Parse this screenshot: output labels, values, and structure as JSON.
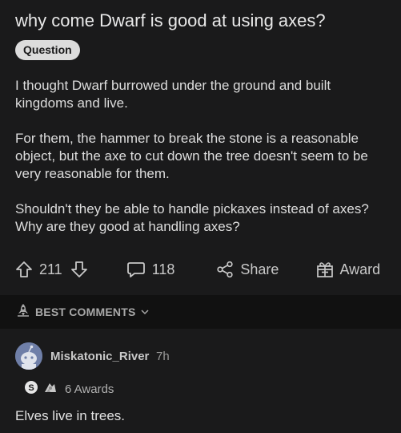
{
  "post": {
    "title": "why come Dwarf is good at using axes?",
    "flair": "Question",
    "paragraphs": [
      "I thought Dwarf burrowed under the ground and built kingdoms and live.",
      "For them, the hammer to break the stone is a reasonable object, but the axe to cut down the tree doesn't seem to be very reasonable for them.",
      "Shouldn't they be able to handle pickaxes instead of axes? Why are they good at handling axes?"
    ]
  },
  "actions": {
    "upvote_icon": "upvote-arrow-icon",
    "vote_count": "211",
    "downvote_icon": "downvote-arrow-icon",
    "comments_icon": "comment-bubble-icon",
    "comment_count": "118",
    "share_icon": "share-nodes-icon",
    "share_label": "Share",
    "award_icon": "gift-box-icon",
    "award_label": "Award"
  },
  "sort": {
    "icon": "rocket-icon",
    "label": "BEST COMMENTS",
    "chevron": "chevron-down-icon"
  },
  "comment": {
    "username": "Miskatonic_River",
    "time": "7h",
    "awards_label": "6 Awards",
    "text": "Elves live in trees."
  },
  "colors": {
    "background": "#1a1a1b",
    "sort_bar": "#111111",
    "text": "#d7dadc",
    "flair_bg": "#dcdcdc"
  }
}
